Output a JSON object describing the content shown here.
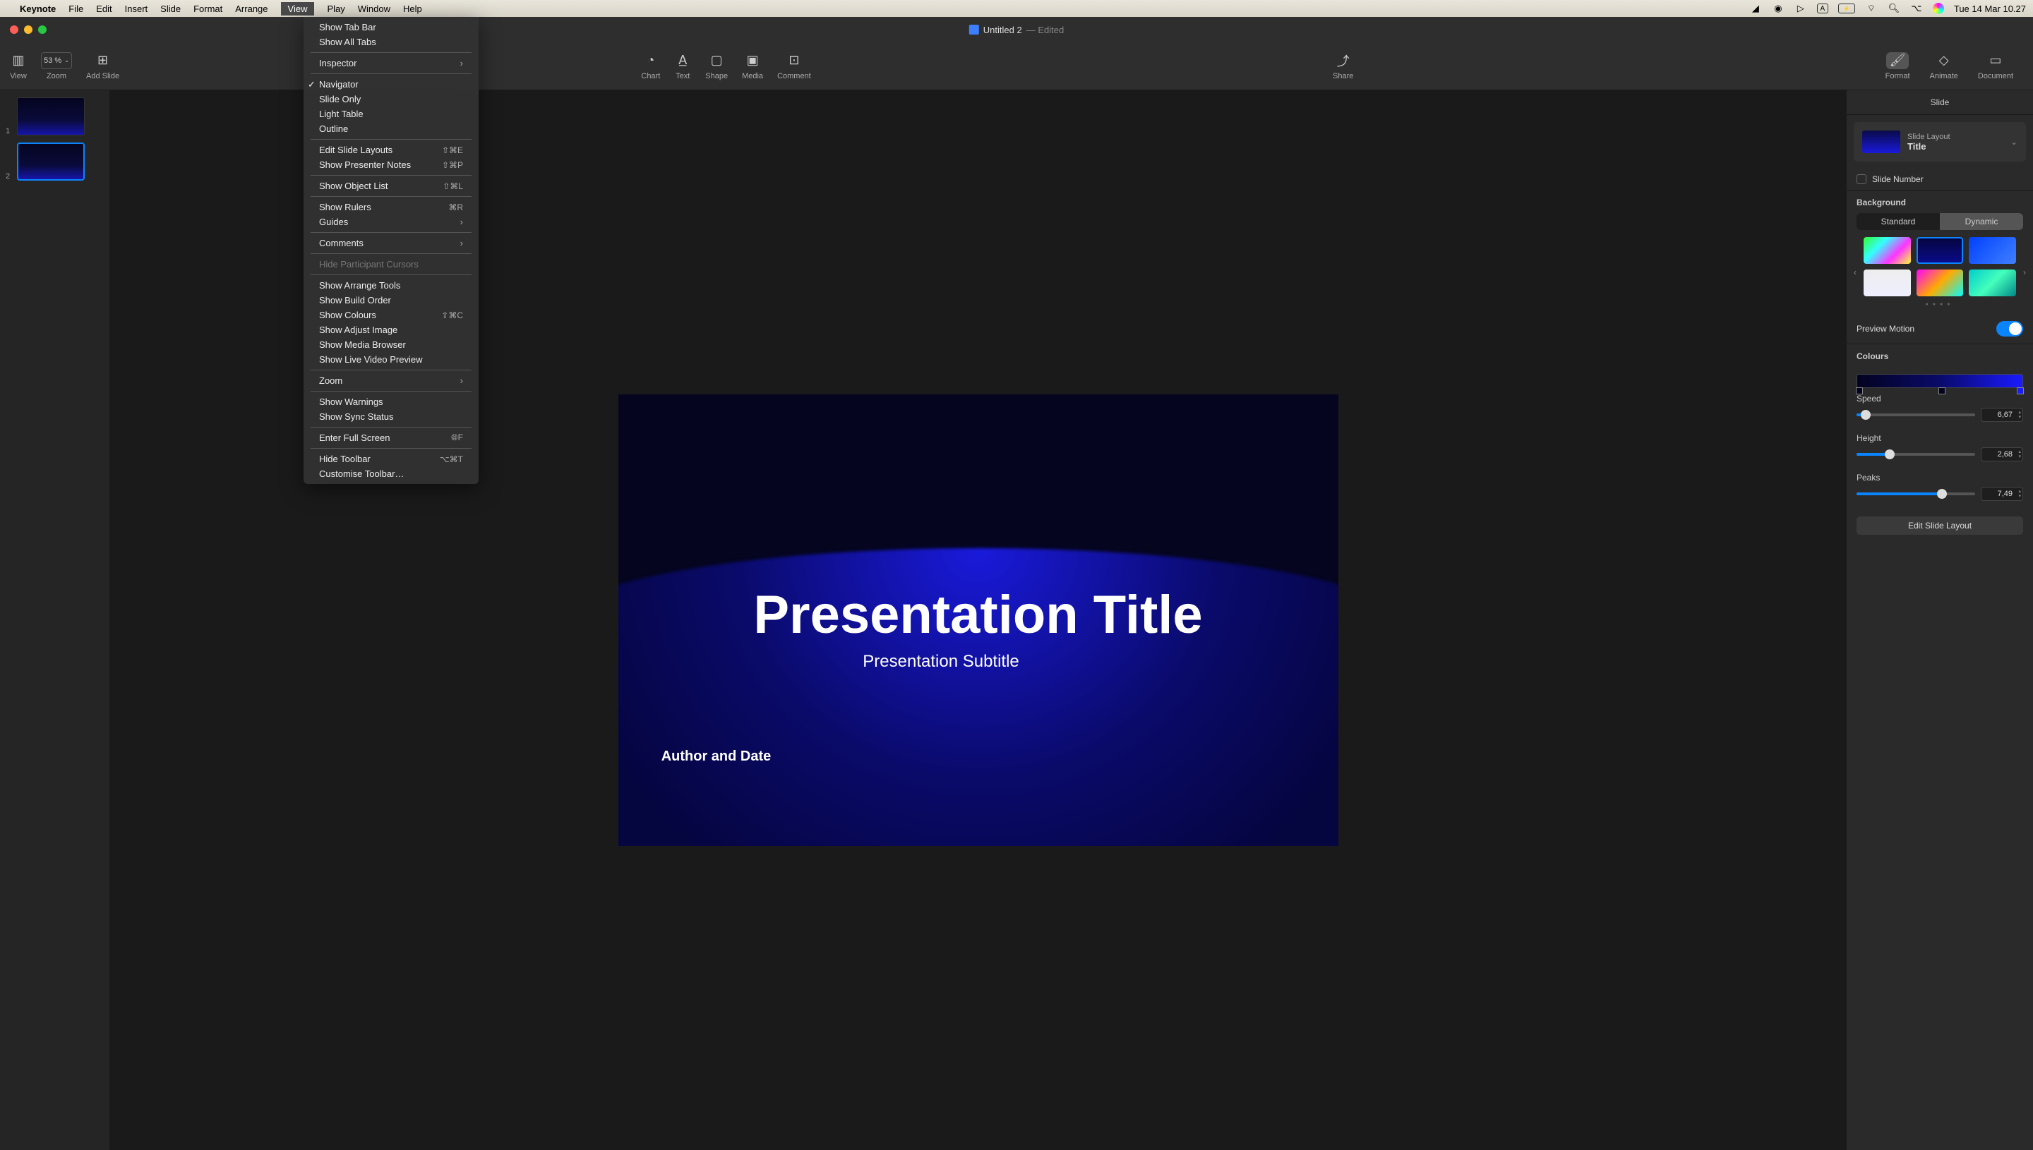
{
  "menubar": {
    "app": "Keynote",
    "items": [
      "File",
      "Edit",
      "Insert",
      "Slide",
      "Format",
      "Arrange",
      "View",
      "Play",
      "Window",
      "Help"
    ],
    "active": "View",
    "clock": "Tue 14 Mar  10.27"
  },
  "window": {
    "title": "Untitled 2",
    "edited": "— Edited"
  },
  "toolbar": {
    "view": "View",
    "zoom": "Zoom",
    "zoom_value": "53 %",
    "add_slide": "Add Slide",
    "chart": "Chart",
    "text": "Text",
    "shape": "Shape",
    "media": "Media",
    "comment": "Comment",
    "share": "Share",
    "format": "Format",
    "animate": "Animate",
    "document": "Document"
  },
  "navigator": {
    "slides": [
      {
        "n": "1"
      },
      {
        "n": "2"
      }
    ],
    "active": 1
  },
  "slide": {
    "title": "Presentation Title",
    "subtitle": "Presentation Subtitle",
    "author": "Author and Date"
  },
  "inspector": {
    "tab": "Slide",
    "layout_label": "Slide Layout",
    "layout_name": "Title",
    "slide_number": "Slide Number",
    "background": "Background",
    "standard": "Standard",
    "dynamic": "Dynamic",
    "preview_motion": "Preview Motion",
    "colours": "Colours",
    "speed": {
      "label": "Speed",
      "value": "6,67",
      "pct": 8
    },
    "height": {
      "label": "Height",
      "value": "2,68",
      "pct": 28
    },
    "peaks": {
      "label": "Peaks",
      "value": "7,49",
      "pct": 72
    },
    "edit": "Edit Slide Layout"
  },
  "menu": {
    "items": [
      {
        "label": "Show Tab Bar"
      },
      {
        "label": "Show All Tabs"
      },
      {
        "sep": true
      },
      {
        "label": "Inspector",
        "sub": true
      },
      {
        "sep": true
      },
      {
        "label": "Navigator",
        "checked": true
      },
      {
        "label": "Slide Only"
      },
      {
        "label": "Light Table"
      },
      {
        "label": "Outline"
      },
      {
        "sep": true
      },
      {
        "label": "Edit Slide Layouts",
        "shortcut": "⇧⌘E"
      },
      {
        "label": "Show Presenter Notes",
        "shortcut": "⇧⌘P"
      },
      {
        "sep": true
      },
      {
        "label": "Show Object List",
        "shortcut": "⇧⌘L"
      },
      {
        "sep": true
      },
      {
        "label": "Show Rulers",
        "shortcut": "⌘R"
      },
      {
        "label": "Guides",
        "sub": true
      },
      {
        "sep": true
      },
      {
        "label": "Comments",
        "sub": true
      },
      {
        "sep": true
      },
      {
        "label": "Hide Participant Cursors",
        "disabled": true
      },
      {
        "sep": true
      },
      {
        "label": "Show Arrange Tools"
      },
      {
        "label": "Show Build Order"
      },
      {
        "label": "Show Colours",
        "shortcut": "⇧⌘C"
      },
      {
        "label": "Show Adjust Image"
      },
      {
        "label": "Show Media Browser"
      },
      {
        "label": "Show Live Video Preview"
      },
      {
        "sep": true
      },
      {
        "label": "Zoom",
        "sub": true
      },
      {
        "sep": true
      },
      {
        "label": "Show Warnings"
      },
      {
        "label": "Show Sync Status"
      },
      {
        "sep": true
      },
      {
        "label": "Enter Full Screen",
        "shortcut": "🌐︎F"
      },
      {
        "sep": true
      },
      {
        "label": "Hide Toolbar",
        "shortcut": "⌥⌘T"
      },
      {
        "label": "Customise Toolbar…"
      }
    ]
  }
}
